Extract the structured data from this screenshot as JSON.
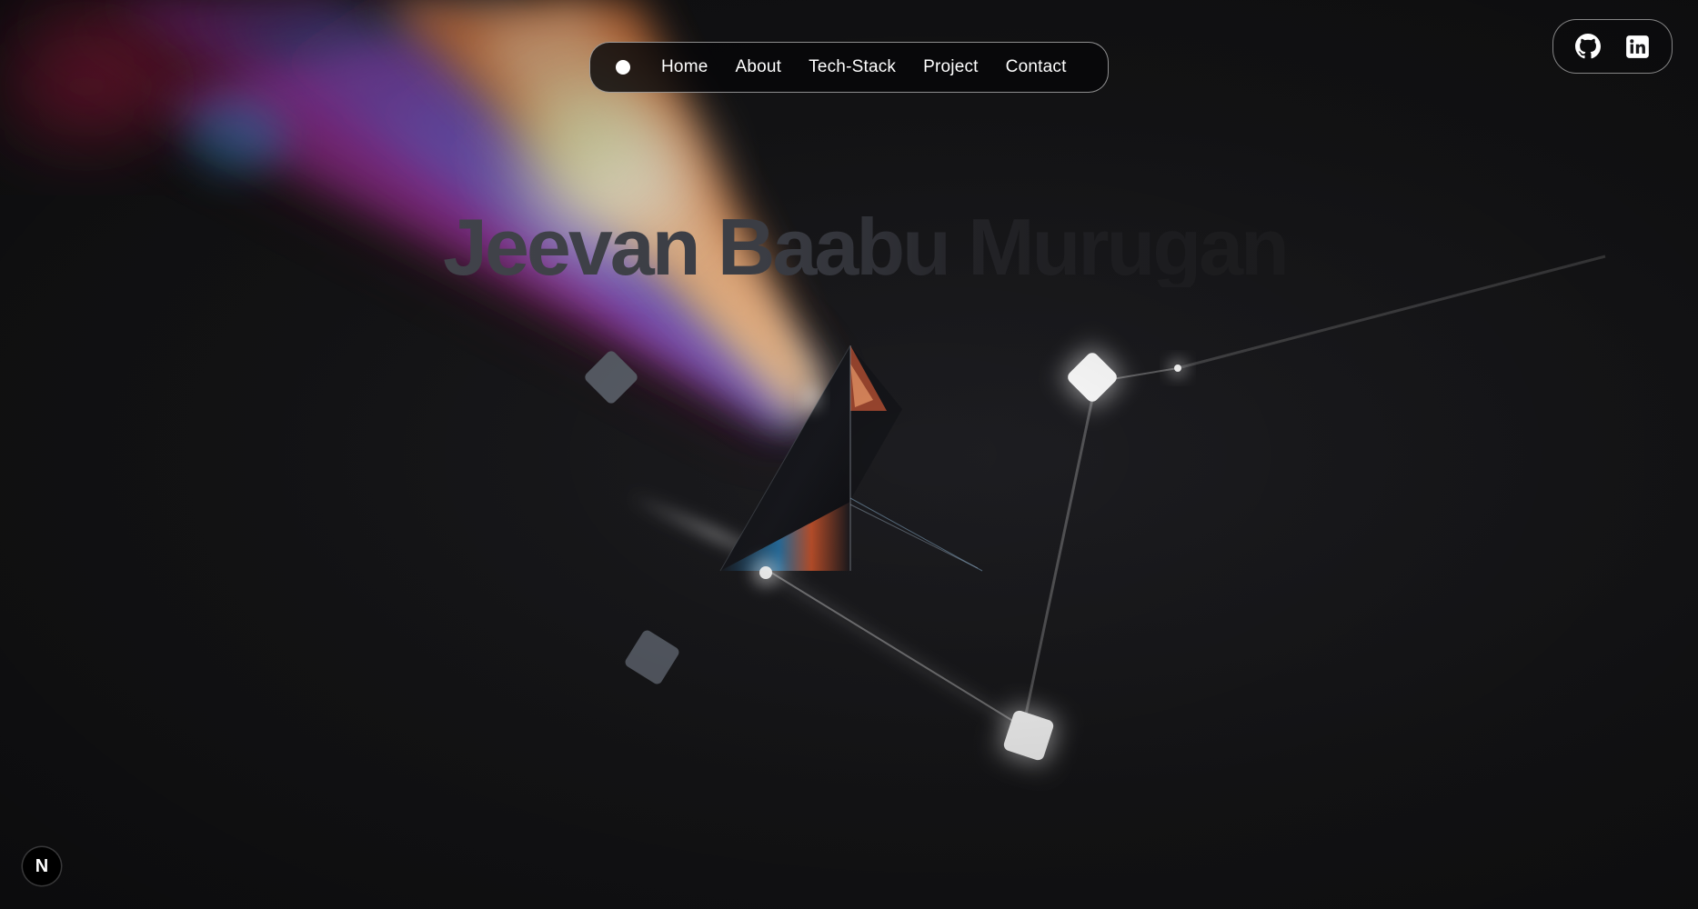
{
  "nav": {
    "items": [
      {
        "label": "Home"
      },
      {
        "label": "About"
      },
      {
        "label": "Tech-Stack"
      },
      {
        "label": "Project"
      },
      {
        "label": "Contact"
      }
    ]
  },
  "hero": {
    "name": "Jeevan Baabu Murugan"
  },
  "social": {
    "icons": [
      "github-icon",
      "linkedin-icon"
    ]
  },
  "badge": {
    "letter": "N",
    "icon": "nextjs-icon"
  },
  "colors": {
    "background": "#18181b",
    "nav_background": "#060608",
    "text": "#ffffff",
    "beam_blue": "#1ea7e0",
    "beam_orange": "#f08a3c",
    "beam_magenta": "#c040c0",
    "beam_red": "#b0203a"
  }
}
